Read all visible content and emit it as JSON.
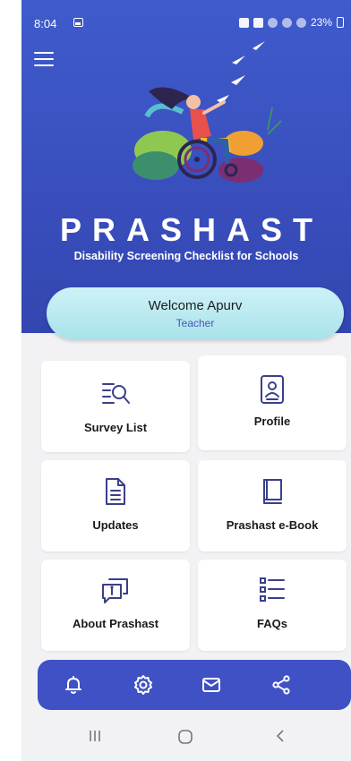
{
  "status_bar": {
    "time": "8:04",
    "battery": "23%"
  },
  "header": {
    "app_name": "PRASHAST",
    "tagline": "Disability Screening Checklist for Schools"
  },
  "welcome": {
    "name": "Welcome Apurv",
    "role": "Teacher"
  },
  "tiles": [
    {
      "label": "Survey List",
      "icon": "survey-list-icon"
    },
    {
      "label": "Profile",
      "icon": "profile-icon"
    },
    {
      "label": "Updates",
      "icon": "document-icon"
    },
    {
      "label": "Prashast e-Book",
      "icon": "book-icon"
    },
    {
      "label": "About Prashast",
      "icon": "info-chat-icon"
    },
    {
      "label": "FAQs",
      "icon": "list-icon"
    }
  ],
  "bottom_nav": [
    "bell-icon",
    "gear-icon",
    "mail-icon",
    "share-icon"
  ],
  "colors": {
    "primary": "#3f51c4",
    "welcome_bg": "#b8e8ee",
    "accent_text": "#4a56b8"
  }
}
